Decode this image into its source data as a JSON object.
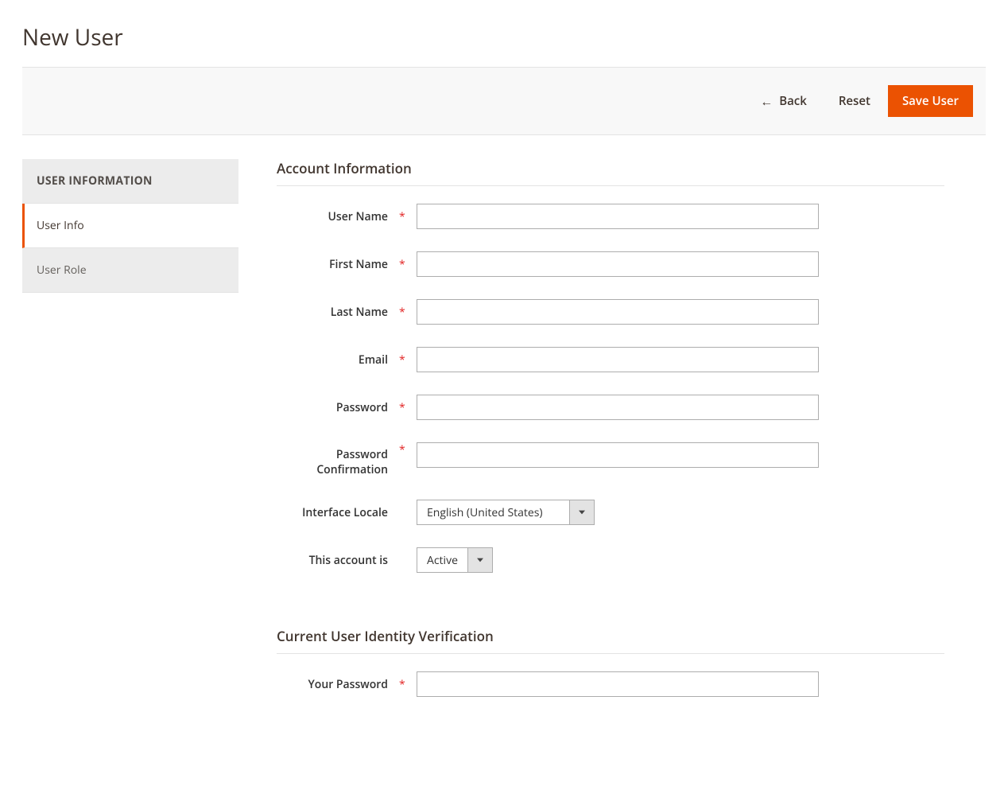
{
  "page": {
    "title": "New User"
  },
  "actions": {
    "back": "Back",
    "reset": "Reset",
    "save": "Save User"
  },
  "sidebar": {
    "header": "USER INFORMATION",
    "items": [
      {
        "label": "User Info"
      },
      {
        "label": "User Role"
      }
    ]
  },
  "sections": {
    "account": {
      "title": "Account Information",
      "fields": {
        "username": {
          "label": "User Name",
          "value": "",
          "required": true
        },
        "firstname": {
          "label": "First Name",
          "value": "",
          "required": true
        },
        "lastname": {
          "label": "Last Name",
          "value": "",
          "required": true
        },
        "email": {
          "label": "Email",
          "value": "",
          "required": true
        },
        "password": {
          "label": "Password",
          "value": "",
          "required": true
        },
        "password_confirm": {
          "label": "Password Confirmation",
          "value": "",
          "required": true
        },
        "locale": {
          "label": "Interface Locale",
          "value": "English (United States)"
        },
        "status": {
          "label": "This account is",
          "value": "Active"
        }
      }
    },
    "verification": {
      "title": "Current User Identity Verification",
      "fields": {
        "your_password": {
          "label": "Your Password",
          "value": "",
          "required": true
        }
      }
    }
  },
  "marks": {
    "required": "*"
  }
}
